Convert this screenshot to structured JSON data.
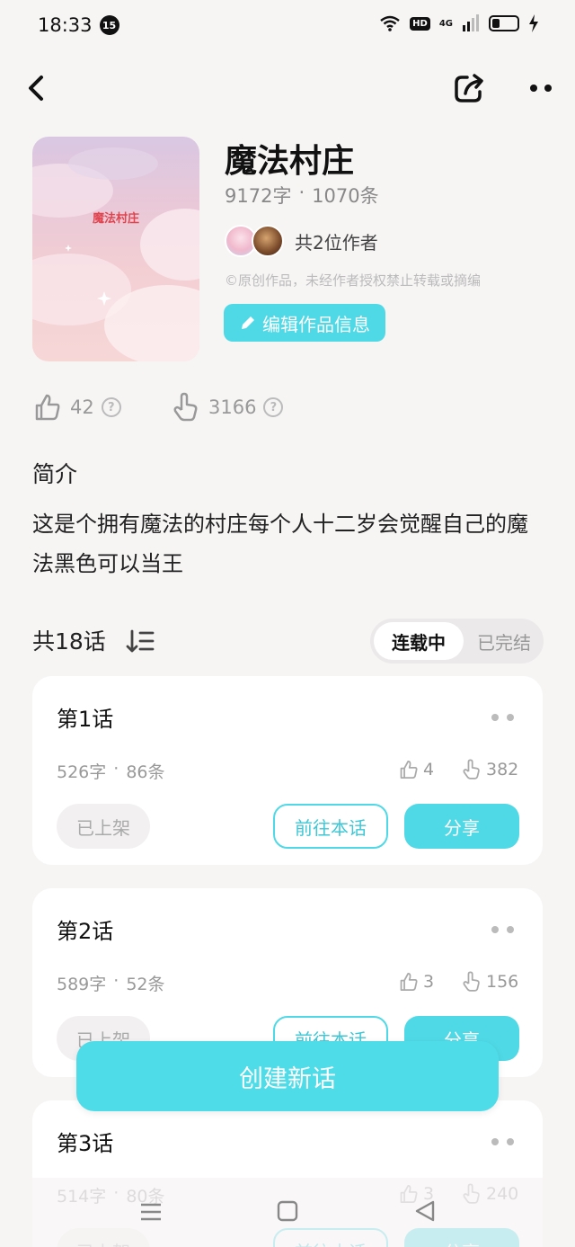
{
  "status_bar": {
    "time": "18:33",
    "notification_count": "15",
    "hd_label": "HD",
    "network_label": "4G"
  },
  "work": {
    "cover_title": "魔法村庄",
    "title": "魔法村庄",
    "word_count": "9172字",
    "separator": "·",
    "entry_count": "1070条",
    "authors_label": "共2位作者",
    "copyright": "©原创作品，未经作者授权禁止转载或摘编",
    "edit_button": "编辑作品信息"
  },
  "metrics": {
    "likes": "42",
    "plays": "3166"
  },
  "intro": {
    "heading": "简介",
    "text": "这是个拥有魔法的村庄每个人十二岁会觉醒自己的魔法黑色可以当王"
  },
  "episodes_header": {
    "count_label": "共18话",
    "toggle_on": "连载中",
    "toggle_off": "已完结"
  },
  "episode_labels": {
    "badge": "已上架",
    "open": "前往本话",
    "share": "分享",
    "separator": "·"
  },
  "episodes": [
    {
      "title": "第1话",
      "words": "526字",
      "entries": "86条",
      "likes": "4",
      "plays": "382"
    },
    {
      "title": "第2话",
      "words": "589字",
      "entries": "52条",
      "likes": "3",
      "plays": "156"
    },
    {
      "title": "第3话",
      "words": "514字",
      "entries": "80条",
      "likes": "3",
      "plays": "240"
    }
  ],
  "create_button": "创建新话",
  "colors": {
    "accent": "#4fd9e6",
    "background": "#f7f4f4"
  }
}
